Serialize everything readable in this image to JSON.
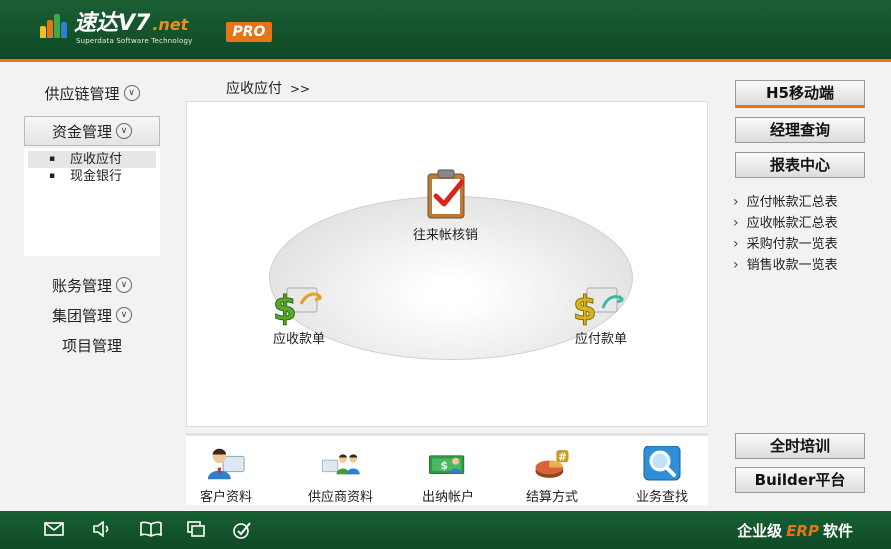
{
  "header": {
    "logo_main": "速达V7",
    "logo_net": ".net",
    "logo_sub": "Superdata Software Technology",
    "pro": "PRO"
  },
  "left_nav": {
    "supply_chain": "供应链管理",
    "funds": "资金管理",
    "funds_sub": [
      "应收应付",
      "现金银行"
    ],
    "accounts": "账务管理",
    "group": "集团管理",
    "project": "项目管理"
  },
  "breadcrumb": {
    "title": "应收应付",
    "arrows": ">>"
  },
  "flow": {
    "top": "往来帐核销",
    "left": "应收款单",
    "right": "应付款单"
  },
  "tools": [
    "客户资料",
    "供应商资料",
    "出纳帐户",
    "结算方式",
    "业务查找"
  ],
  "right_panel": {
    "h5": "H5移动端",
    "manager": "经理查询",
    "reports": "报表中心",
    "links": [
      "应付帐款汇总表",
      "应收帐款汇总表",
      "采购付款一览表",
      "销售收款一览表"
    ],
    "training": "全时培训",
    "builder": "Builder平台"
  },
  "footer": {
    "brand_pre": "企业级",
    "brand_erp": "ERP",
    "brand_post": "软件"
  },
  "colors": {
    "header_green": "#1b5e34",
    "accent_orange": "#e8741a"
  }
}
